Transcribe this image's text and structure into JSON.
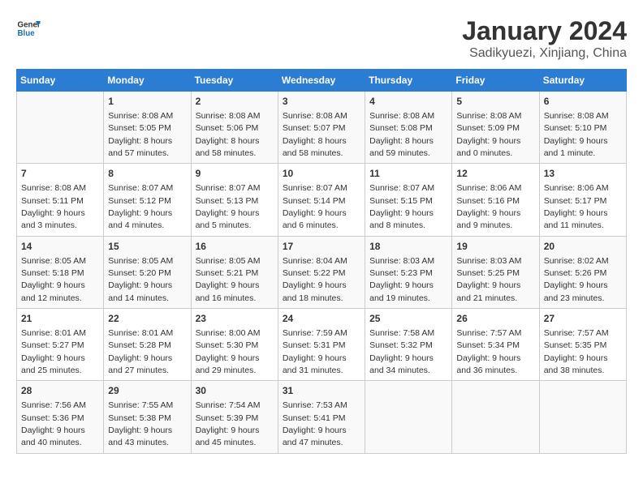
{
  "header": {
    "logo_line1": "General",
    "logo_line2": "Blue",
    "title": "January 2024",
    "subtitle": "Sadikyuezi, Xinjiang, China"
  },
  "calendar": {
    "days_of_week": [
      "Sunday",
      "Monday",
      "Tuesday",
      "Wednesday",
      "Thursday",
      "Friday",
      "Saturday"
    ],
    "weeks": [
      [
        {
          "day": "",
          "info": ""
        },
        {
          "day": "1",
          "info": "Sunrise: 8:08 AM\nSunset: 5:05 PM\nDaylight: 8 hours\nand 57 minutes."
        },
        {
          "day": "2",
          "info": "Sunrise: 8:08 AM\nSunset: 5:06 PM\nDaylight: 8 hours\nand 58 minutes."
        },
        {
          "day": "3",
          "info": "Sunrise: 8:08 AM\nSunset: 5:07 PM\nDaylight: 8 hours\nand 58 minutes."
        },
        {
          "day": "4",
          "info": "Sunrise: 8:08 AM\nSunset: 5:08 PM\nDaylight: 8 hours\nand 59 minutes."
        },
        {
          "day": "5",
          "info": "Sunrise: 8:08 AM\nSunset: 5:09 PM\nDaylight: 9 hours\nand 0 minutes."
        },
        {
          "day": "6",
          "info": "Sunrise: 8:08 AM\nSunset: 5:10 PM\nDaylight: 9 hours\nand 1 minute."
        }
      ],
      [
        {
          "day": "7",
          "info": "Sunrise: 8:08 AM\nSunset: 5:11 PM\nDaylight: 9 hours\nand 3 minutes."
        },
        {
          "day": "8",
          "info": "Sunrise: 8:07 AM\nSunset: 5:12 PM\nDaylight: 9 hours\nand 4 minutes."
        },
        {
          "day": "9",
          "info": "Sunrise: 8:07 AM\nSunset: 5:13 PM\nDaylight: 9 hours\nand 5 minutes."
        },
        {
          "day": "10",
          "info": "Sunrise: 8:07 AM\nSunset: 5:14 PM\nDaylight: 9 hours\nand 6 minutes."
        },
        {
          "day": "11",
          "info": "Sunrise: 8:07 AM\nSunset: 5:15 PM\nDaylight: 9 hours\nand 8 minutes."
        },
        {
          "day": "12",
          "info": "Sunrise: 8:06 AM\nSunset: 5:16 PM\nDaylight: 9 hours\nand 9 minutes."
        },
        {
          "day": "13",
          "info": "Sunrise: 8:06 AM\nSunset: 5:17 PM\nDaylight: 9 hours\nand 11 minutes."
        }
      ],
      [
        {
          "day": "14",
          "info": "Sunrise: 8:05 AM\nSunset: 5:18 PM\nDaylight: 9 hours\nand 12 minutes."
        },
        {
          "day": "15",
          "info": "Sunrise: 8:05 AM\nSunset: 5:20 PM\nDaylight: 9 hours\nand 14 minutes."
        },
        {
          "day": "16",
          "info": "Sunrise: 8:05 AM\nSunset: 5:21 PM\nDaylight: 9 hours\nand 16 minutes."
        },
        {
          "day": "17",
          "info": "Sunrise: 8:04 AM\nSunset: 5:22 PM\nDaylight: 9 hours\nand 18 minutes."
        },
        {
          "day": "18",
          "info": "Sunrise: 8:03 AM\nSunset: 5:23 PM\nDaylight: 9 hours\nand 19 minutes."
        },
        {
          "day": "19",
          "info": "Sunrise: 8:03 AM\nSunset: 5:25 PM\nDaylight: 9 hours\nand 21 minutes."
        },
        {
          "day": "20",
          "info": "Sunrise: 8:02 AM\nSunset: 5:26 PM\nDaylight: 9 hours\nand 23 minutes."
        }
      ],
      [
        {
          "day": "21",
          "info": "Sunrise: 8:01 AM\nSunset: 5:27 PM\nDaylight: 9 hours\nand 25 minutes."
        },
        {
          "day": "22",
          "info": "Sunrise: 8:01 AM\nSunset: 5:28 PM\nDaylight: 9 hours\nand 27 minutes."
        },
        {
          "day": "23",
          "info": "Sunrise: 8:00 AM\nSunset: 5:30 PM\nDaylight: 9 hours\nand 29 minutes."
        },
        {
          "day": "24",
          "info": "Sunrise: 7:59 AM\nSunset: 5:31 PM\nDaylight: 9 hours\nand 31 minutes."
        },
        {
          "day": "25",
          "info": "Sunrise: 7:58 AM\nSunset: 5:32 PM\nDaylight: 9 hours\nand 34 minutes."
        },
        {
          "day": "26",
          "info": "Sunrise: 7:57 AM\nSunset: 5:34 PM\nDaylight: 9 hours\nand 36 minutes."
        },
        {
          "day": "27",
          "info": "Sunrise: 7:57 AM\nSunset: 5:35 PM\nDaylight: 9 hours\nand 38 minutes."
        }
      ],
      [
        {
          "day": "28",
          "info": "Sunrise: 7:56 AM\nSunset: 5:36 PM\nDaylight: 9 hours\nand 40 minutes."
        },
        {
          "day": "29",
          "info": "Sunrise: 7:55 AM\nSunset: 5:38 PM\nDaylight: 9 hours\nand 43 minutes."
        },
        {
          "day": "30",
          "info": "Sunrise: 7:54 AM\nSunset: 5:39 PM\nDaylight: 9 hours\nand 45 minutes."
        },
        {
          "day": "31",
          "info": "Sunrise: 7:53 AM\nSunset: 5:41 PM\nDaylight: 9 hours\nand 47 minutes."
        },
        {
          "day": "",
          "info": ""
        },
        {
          "day": "",
          "info": ""
        },
        {
          "day": "",
          "info": ""
        }
      ]
    ]
  }
}
